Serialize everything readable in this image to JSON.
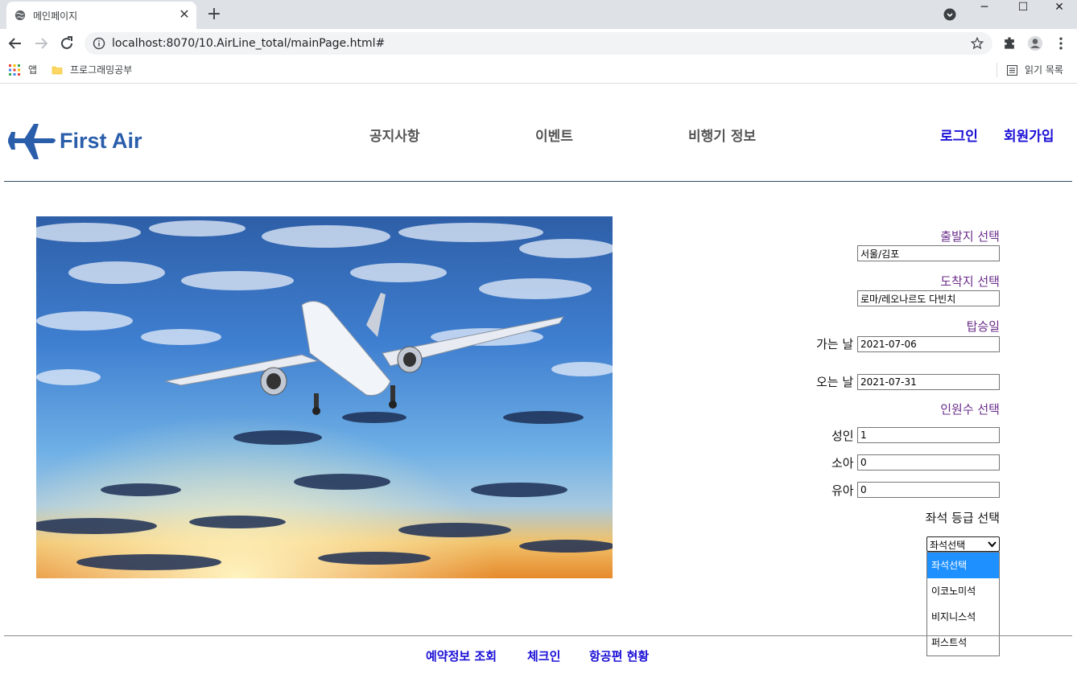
{
  "browser": {
    "tab_title": "메인페이지",
    "url": "localhost:8070/10.AirLine_total/mainPage.html#",
    "bookmarks": [
      {
        "label": "앱",
        "icon": "apps-grid-icon"
      },
      {
        "label": "프로그래밍공부",
        "icon": "folder-icon"
      }
    ],
    "reading_list": "읽기 목록"
  },
  "site": {
    "logo_text": "First Air",
    "nav": [
      "공지사항",
      "이벤트",
      "비행기 정보"
    ],
    "auth": {
      "login": "로그인",
      "signup": "회원가입"
    }
  },
  "booking": {
    "departure_label": "출발지 선택",
    "departure_value": "서울/김포",
    "arrival_label": "도착지 선택",
    "arrival_value": "로마/레오나르도 다빈치",
    "date_label": "탑승일",
    "go_label": "가는 날",
    "go_value": "2021-07-06",
    "return_label": "오는 날",
    "return_value": "2021-07-31",
    "people_label": "인원수 선택",
    "adult_label": "성인",
    "adult_value": "1",
    "child_label": "소아",
    "child_value": "0",
    "infant_label": "유아",
    "infant_value": "0",
    "seat_label": "좌석 등급 선택",
    "seat_selected": "좌석선택",
    "seat_options": [
      "좌석선택",
      "이코노미석",
      "비지니스석",
      "퍼스트석"
    ]
  },
  "footer": {
    "links": [
      "예약정보 조회",
      "체크인",
      "항공편 현황"
    ]
  },
  "colors": {
    "brand": "#2a5eab",
    "link": "#1a0fd6",
    "label": "#6a2c8a"
  }
}
